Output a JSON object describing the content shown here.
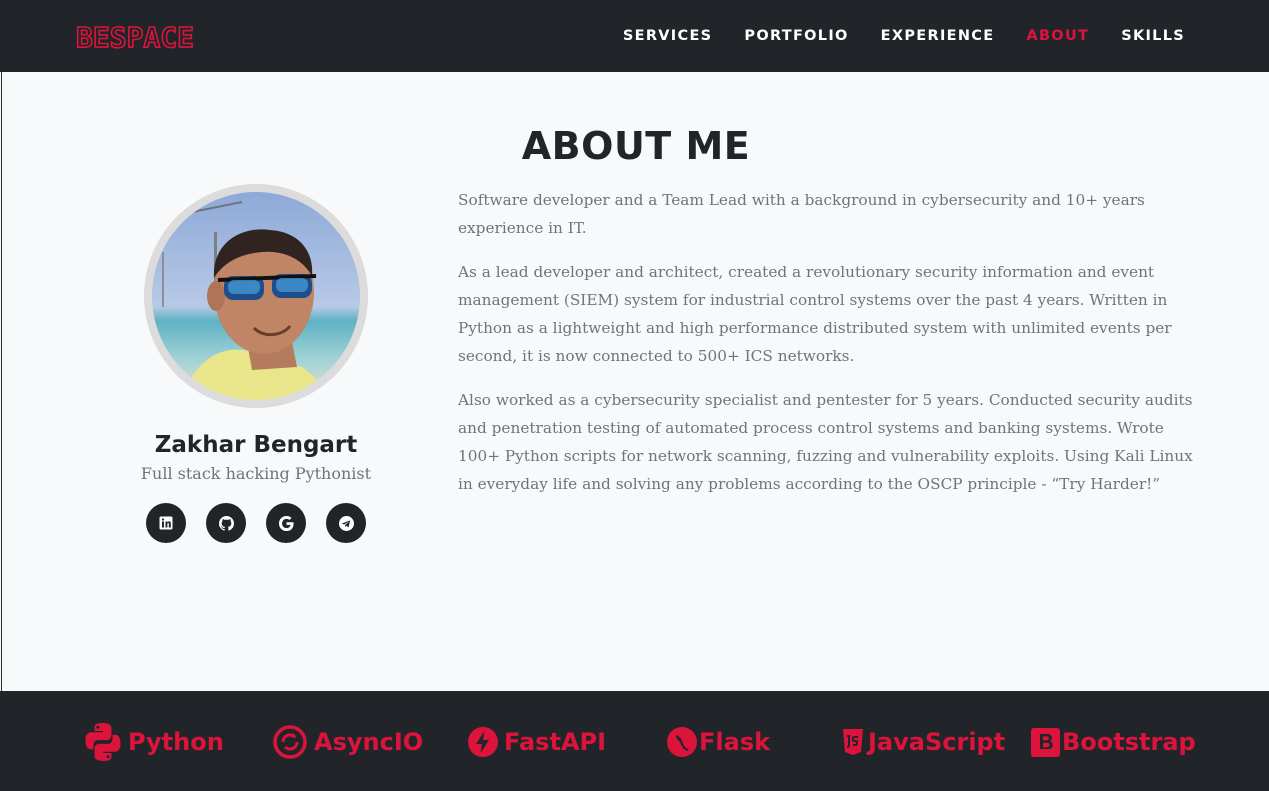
{
  "brand": {
    "logo_text": "BESPACE",
    "color": "#dc143c"
  },
  "nav": {
    "items": [
      {
        "label": "SERVICES",
        "active": false
      },
      {
        "label": "PORTFOLIO",
        "active": false
      },
      {
        "label": "EXPERIENCE",
        "active": false
      },
      {
        "label": "ABOUT",
        "active": true
      },
      {
        "label": "SKILLS",
        "active": false
      }
    ]
  },
  "about": {
    "title": "ABOUT ME",
    "name": "Zakhar Bengart",
    "role": "Full stack hacking Pythonist",
    "paragraphs": [
      "Software developer and a Team Lead with a background in cybersecurity and 10+ years experience in IT.",
      "As a lead developer and architect, created a revolutionary security information and event management (SIEM) system for industrial control systems over the past 4 years. Written in Python as a lightweight and high performance distributed system with unlimited events per second, it is now connected to 500+ ICS networks.",
      "Also worked as a cybersecurity specialist and pentester for 5 years. Conducted security audits and penetration testing of automated process control systems and banking systems. Wrote 100+ Python scripts for network scanning, fuzzing and vulnerability exploits. Using Kali Linux in everyday life and solving any problems according to the OSCP principle - “Try Harder!”"
    ],
    "socials": [
      {
        "icon": "linkedin-icon"
      },
      {
        "icon": "github-icon"
      },
      {
        "icon": "google-icon"
      },
      {
        "icon": "telegram-icon"
      }
    ]
  },
  "skills": [
    {
      "label": "Python",
      "icon": "python-icon"
    },
    {
      "label": "AsyncIO",
      "icon": "asyncio-icon"
    },
    {
      "label": "FastAPI",
      "icon": "fastapi-icon"
    },
    {
      "label": "Flask",
      "icon": "flask-icon"
    },
    {
      "label": "JavaScript",
      "icon": "javascript-icon"
    },
    {
      "label": "Bootstrap",
      "icon": "bootstrap-icon"
    }
  ],
  "colors": {
    "dark": "#212529",
    "accent": "#dc143c",
    "light": "#f8f9fa",
    "muted": "#6c757d"
  }
}
